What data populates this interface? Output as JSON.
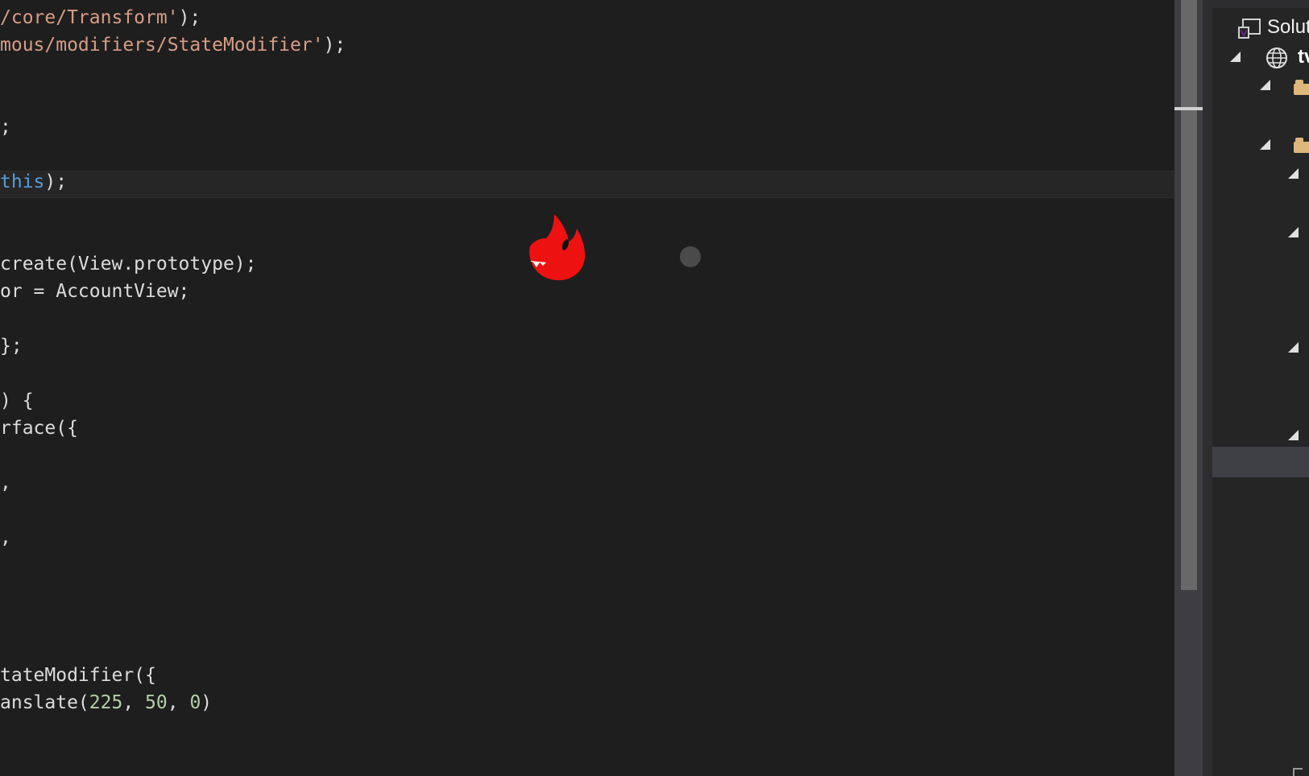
{
  "editor": {
    "lines": [
      {
        "segments": [
          {
            "t": "/core/Transform'",
            "c": "str"
          },
          {
            "t": ");",
            "c": "id"
          }
        ]
      },
      {
        "segments": [
          {
            "t": "mous/modifiers/StateModifier'",
            "c": "str"
          },
          {
            "t": ");",
            "c": "id"
          }
        ]
      },
      {
        "segments": [
          {
            "t": ";",
            "c": "id"
          }
        ]
      },
      {
        "segments": [
          {
            "t": "this",
            "c": "kw"
          },
          {
            "t": ");",
            "c": "id"
          }
        ]
      },
      {
        "segments": [
          {
            "t": "create(View.prototype);",
            "c": "id"
          }
        ]
      },
      {
        "segments": [
          {
            "t": "or = AccountView;",
            "c": "id"
          }
        ]
      },
      {
        "segments": [
          {
            "t": "};",
            "c": "id"
          }
        ]
      },
      {
        "segments": [
          {
            "t": ") {",
            "c": "id"
          }
        ]
      },
      {
        "segments": [
          {
            "t": "rface({",
            "c": "id"
          }
        ]
      },
      {
        "segments": [
          {
            "t": ",",
            "c": "id"
          }
        ]
      },
      {
        "segments": [
          {
            "t": ",",
            "c": "id"
          }
        ]
      },
      {
        "segments": [
          {
            "t": "tateModifier({",
            "c": "id"
          }
        ]
      },
      {
        "segments": [
          {
            "t": "anslate(",
            "c": "id"
          },
          {
            "t": "225",
            "c": "num"
          },
          {
            "t": ", ",
            "c": "id"
          },
          {
            "t": "50",
            "c": "num"
          },
          {
            "t": ", ",
            "c": "id"
          },
          {
            "t": "0",
            "c": "num"
          },
          {
            "t": ")",
            "c": "id"
          }
        ]
      }
    ],
    "colors": {
      "background": "#1e1e1e",
      "string": "#d69d85",
      "keyword": "#569cd6",
      "number": "#b5cea8",
      "identifier": "#dcdcdc"
    }
  },
  "solution_explorer": {
    "title": "Solut",
    "project": "tv",
    "icons": [
      "solution-icon",
      "globe-icon",
      "folder-icon",
      "folder-icon"
    ]
  },
  "overlay": {
    "mascot": "red-mascot-icon",
    "ball": "gray-ball"
  }
}
